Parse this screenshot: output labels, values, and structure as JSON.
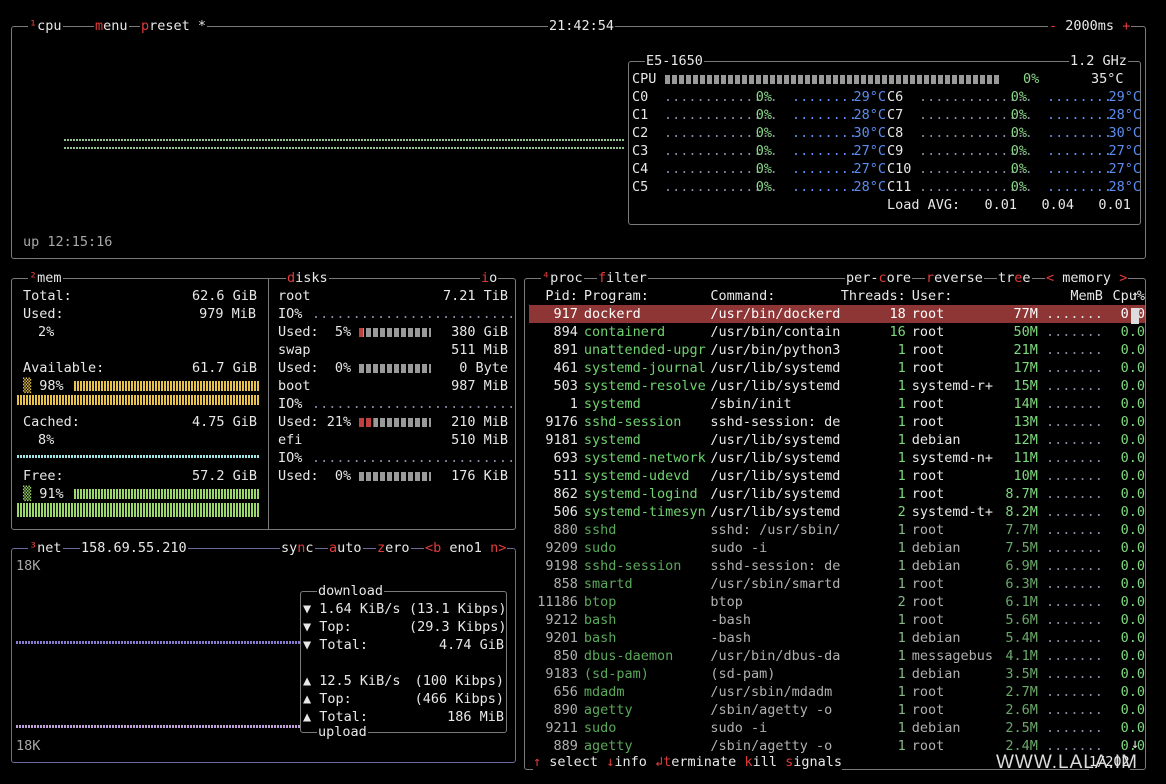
{
  "top": {
    "cpu_title": "cpu",
    "menu_title": "menu",
    "preset_title": "preset *",
    "clock": "21:42:54",
    "interval": "2000ms",
    "interval_minus": "-",
    "interval_plus": "+",
    "uptime": "up 12:15:16"
  },
  "cpuinfo": {
    "model": "E5-1650",
    "freq": "1.2 GHz",
    "cpu_label": "CPU",
    "cpu_pct": "0%",
    "cpu_temp": "35°C",
    "cores_left": [
      {
        "n": "C0",
        "pct": "0%",
        "t": "29°C"
      },
      {
        "n": "C1",
        "pct": "0%",
        "t": "28°C"
      },
      {
        "n": "C2",
        "pct": "0%",
        "t": "30°C"
      },
      {
        "n": "C3",
        "pct": "0%",
        "t": "27°C"
      },
      {
        "n": "C4",
        "pct": "0%",
        "t": "27°C"
      },
      {
        "n": "C5",
        "pct": "0%",
        "t": "28°C"
      }
    ],
    "cores_right": [
      {
        "n": "C6",
        "pct": "0%",
        "t": "29°C"
      },
      {
        "n": "C7",
        "pct": "0%",
        "t": "28°C"
      },
      {
        "n": "C8",
        "pct": "0%",
        "t": "30°C"
      },
      {
        "n": "C9",
        "pct": "0%",
        "t": "27°C"
      },
      {
        "n": "C10",
        "pct": "0%",
        "t": "27°C"
      },
      {
        "n": "C11",
        "pct": "0%",
        "t": "28°C"
      }
    ],
    "load_label": "Load AVG:",
    "load": [
      "0.01",
      "0.04",
      "0.01"
    ]
  },
  "mem": {
    "title": "mem",
    "total_l": "Total:",
    "total": "62.6 GiB",
    "used_l": "Used:",
    "used": "979 MiB",
    "used_pct": "2%",
    "avail_l": "Available:",
    "avail": "61.7 GiB",
    "avail_pct": "98%",
    "cached_l": "Cached:",
    "cached": "4.75 GiB",
    "cached_pct": "8%",
    "free_l": "Free:",
    "free": "57.2 GiB",
    "free_pct": "91%"
  },
  "disks": {
    "title": "disks",
    "io": "io",
    "items": [
      {
        "name": "root",
        "size": "7.21 TiB",
        "io": "IO%",
        "used_l": "Used:",
        "pct": "5%",
        "used": "380 GiB"
      },
      {
        "name": "swap",
        "size": "511 MiB",
        "used_l": "Used:",
        "pct": "0%",
        "used": "0 Byte"
      },
      {
        "name": "boot",
        "size": "987 MiB",
        "io": "IO%",
        "used_l": "Used:",
        "pct": "21%",
        "used": "210 MiB"
      },
      {
        "name": "efi",
        "size": "510 MiB",
        "io": "IO%",
        "used_l": "Used:",
        "pct": "0%",
        "used": "176 KiB"
      }
    ]
  },
  "net": {
    "title": "net",
    "ip": "158.69.55.210",
    "sync": "sync",
    "auto": "auto",
    "zero": "zero",
    "prev": "<b",
    "iface": "eno1",
    "next": "n>",
    "scale_top": "18K",
    "scale_bot": "18K",
    "dl_title": "download",
    "dl_rate": "1.64 KiB/s",
    "dl_bits": "(13.1 Kibps)",
    "dl_top_l": "Top:",
    "dl_top": "(29.3 Kibps)",
    "dl_total_l": "Total:",
    "dl_total": "4.74 GiB",
    "ul_rate": "12.5 KiB/s",
    "ul_bits": "(100 Kibps)",
    "ul_top_l": "Top:",
    "ul_top": "(466 Kibps)",
    "ul_total_l": "Total:",
    "ul_total": "186 MiB",
    "ul_title": "upload"
  },
  "proc": {
    "title": "proc",
    "filter": "filter",
    "per_core": "per-core",
    "reverse": "reverse",
    "tree": "tree",
    "sort_prev": "<",
    "sort": "memory",
    "sort_next": ">",
    "headers": [
      "Pid:",
      "Program:",
      "Command:",
      "Threads:",
      "User:",
      "MemB",
      "Cpu%"
    ],
    "rows": [
      [
        "917",
        "dockerd",
        "/usr/bin/dockerd",
        "18",
        "root",
        "77M",
        "0.0"
      ],
      [
        "894",
        "containerd",
        "/usr/bin/contain",
        "16",
        "root",
        "50M",
        "0.0"
      ],
      [
        "891",
        "unattended-upgr",
        "/usr/bin/python3",
        "1",
        "root",
        "21M",
        "0.0"
      ],
      [
        "461",
        "systemd-journal",
        "/usr/lib/systemd",
        "1",
        "root",
        "17M",
        "0.0"
      ],
      [
        "503",
        "systemd-resolve",
        "/usr/lib/systemd",
        "1",
        "systemd-r+",
        "15M",
        "0.0"
      ],
      [
        "1",
        "systemd",
        "/sbin/init",
        "1",
        "root",
        "14M",
        "0.0"
      ],
      [
        "9176",
        "sshd-session",
        "sshd-session: de",
        "1",
        "root",
        "13M",
        "0.0"
      ],
      [
        "9181",
        "systemd",
        "/usr/lib/systemd",
        "1",
        "debian",
        "12M",
        "0.0"
      ],
      [
        "693",
        "systemd-network",
        "/usr/lib/systemd",
        "1",
        "systemd-n+",
        "11M",
        "0.0"
      ],
      [
        "511",
        "systemd-udevd",
        "/usr/lib/systemd",
        "1",
        "root",
        "10M",
        "0.0"
      ],
      [
        "862",
        "systemd-logind",
        "/usr/lib/systemd",
        "1",
        "root",
        "8.7M",
        "0.0"
      ],
      [
        "506",
        "systemd-timesyn",
        "/usr/lib/systemd",
        "2",
        "systemd-t+",
        "8.2M",
        "0.0"
      ],
      [
        "880",
        "sshd",
        "sshd: /usr/sbin/",
        "1",
        "root",
        "7.7M",
        "0.0"
      ],
      [
        "9209",
        "sudo",
        "sudo -i",
        "1",
        "debian",
        "7.5M",
        "0.0"
      ],
      [
        "9198",
        "sshd-session",
        "sshd-session: de",
        "1",
        "debian",
        "6.9M",
        "0.0"
      ],
      [
        "858",
        "smartd",
        "/usr/sbin/smartd",
        "1",
        "root",
        "6.3M",
        "0.0"
      ],
      [
        "11186",
        "btop",
        "btop",
        "2",
        "root",
        "6.1M",
        "0.0"
      ],
      [
        "9212",
        "bash",
        "-bash",
        "1",
        "root",
        "5.6M",
        "0.0"
      ],
      [
        "9201",
        "bash",
        "-bash",
        "1",
        "debian",
        "5.4M",
        "0.0"
      ],
      [
        "850",
        "dbus-daemon",
        "/usr/bin/dbus-da",
        "1",
        "messagebus",
        "4.1M",
        "0.0"
      ],
      [
        "9183",
        "(sd-pam)",
        "(sd-pam)",
        "1",
        "debian",
        "3.5M",
        "0.0"
      ],
      [
        "656",
        "mdadm",
        "/usr/sbin/mdadm",
        "1",
        "root",
        "2.7M",
        "0.0"
      ],
      [
        "890",
        "agetty",
        "/sbin/agetty -o",
        "1",
        "root",
        "2.6M",
        "0.0"
      ],
      [
        "9211",
        "sudo",
        "sudo -i",
        "1",
        "debian",
        "2.5M",
        "0.0"
      ],
      [
        "889",
        "agetty",
        "/sbin/agetty -o",
        "1",
        "root",
        "2.4M",
        "0.0"
      ]
    ],
    "footer_select": "select",
    "footer_info": "info",
    "footer_terminate": "terminate",
    "footer_kill": "kill",
    "footer_signals": "signals",
    "count": "1/202"
  },
  "watermark": "WWW.LALA.IM",
  "colors": {
    "selected_row": "#8e3636",
    "accent_red": "#e23b3b",
    "temp_blue": "#5c8df0",
    "prog_green": "#6ed26e"
  }
}
